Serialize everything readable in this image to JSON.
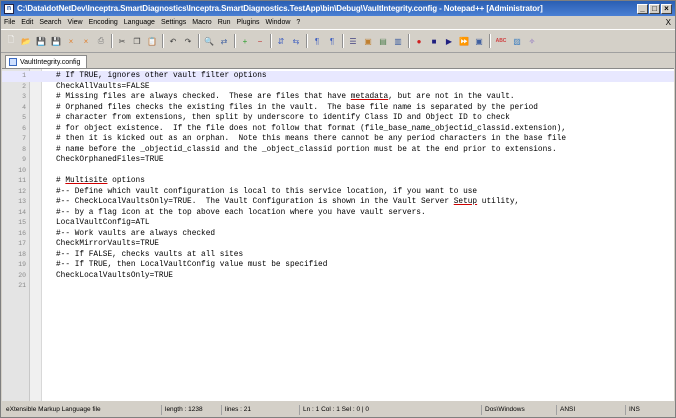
{
  "window": {
    "title": "C:\\Data\\dotNetDev\\Inceptra.SmartDiagnostics\\Inceptra.SmartDiagnostics.TestApp\\bin\\Debug\\VaultIntegrity.config - Notepad++ [Administrator]",
    "app_icon_glyph": "n",
    "controls": {
      "minimize": "_",
      "maximize": "□",
      "close": "×"
    }
  },
  "menu": {
    "items": [
      "File",
      "Edit",
      "Search",
      "View",
      "Encoding",
      "Language",
      "Settings",
      "Macro",
      "Run",
      "Plugins",
      "Window",
      "?"
    ],
    "close_doc": "X"
  },
  "toolbar": {
    "icons": [
      {
        "name": "new-file-icon",
        "glyph": "🗋",
        "color": "#ffffff"
      },
      {
        "name": "open-file-icon",
        "glyph": "📂",
        "color": "#f0c040"
      },
      {
        "name": "save-icon",
        "glyph": "💾",
        "color": "#6080c0"
      },
      {
        "name": "save-all-icon",
        "glyph": "💾",
        "color": "#6080c0"
      },
      {
        "name": "close-icon",
        "glyph": "×",
        "color": "#e08030"
      },
      {
        "name": "close-all-icon",
        "glyph": "×",
        "color": "#e08030"
      },
      {
        "name": "print-icon",
        "glyph": "⎙",
        "color": "#808080"
      },
      {
        "sep": true
      },
      {
        "name": "cut-icon",
        "glyph": "✂",
        "color": "#404040"
      },
      {
        "name": "copy-icon",
        "glyph": "❐",
        "color": "#404040"
      },
      {
        "name": "paste-icon",
        "glyph": "📋",
        "color": "#c09040"
      },
      {
        "sep": true
      },
      {
        "name": "undo-icon",
        "glyph": "↶",
        "color": "#404040"
      },
      {
        "name": "redo-icon",
        "glyph": "↷",
        "color": "#404040"
      },
      {
        "sep": true
      },
      {
        "name": "find-icon",
        "glyph": "🔍",
        "color": "#404040"
      },
      {
        "name": "replace-icon",
        "glyph": "⇄",
        "color": "#4060a0"
      },
      {
        "sep": true
      },
      {
        "name": "zoom-in-icon",
        "glyph": "+",
        "color": "#30a030"
      },
      {
        "name": "zoom-out-icon",
        "glyph": "−",
        "color": "#c03030"
      },
      {
        "sep": true
      },
      {
        "name": "sync-vertical-icon",
        "glyph": "⇵",
        "color": "#4060c0"
      },
      {
        "name": "sync-horizontal-icon",
        "glyph": "⇆",
        "color": "#4060c0"
      },
      {
        "sep": true
      },
      {
        "name": "word-wrap-icon",
        "glyph": "¶",
        "color": "#4060c0"
      },
      {
        "name": "show-all-chars-icon",
        "glyph": "¶",
        "color": "#4060c0"
      },
      {
        "sep": true
      },
      {
        "name": "indent-guide-icon",
        "glyph": "☰",
        "color": "#404080"
      },
      {
        "name": "language-icon",
        "glyph": "▣",
        "color": "#c08030"
      },
      {
        "name": "doc-map-icon",
        "glyph": "▤",
        "color": "#508050"
      },
      {
        "name": "function-list-icon",
        "glyph": "▥",
        "color": "#4060a0"
      },
      {
        "sep": true
      },
      {
        "name": "record-macro-icon",
        "glyph": "●",
        "color": "#d02020"
      },
      {
        "name": "stop-macro-icon",
        "glyph": "■",
        "color": "#202080"
      },
      {
        "name": "play-macro-icon",
        "glyph": "▶",
        "color": "#202080"
      },
      {
        "name": "run-macro-multiple-icon",
        "glyph": "⏩",
        "color": "#202080"
      },
      {
        "name": "save-macro-icon",
        "glyph": "▣",
        "color": "#4060a0"
      },
      {
        "sep": true
      },
      {
        "name": "spellcheck-icon",
        "glyph": "ABC",
        "color": "#d04040"
      },
      {
        "name": "plugin-icon",
        "glyph": "▨",
        "color": "#4080c0"
      },
      {
        "name": "tools-icon",
        "glyph": "✧",
        "color": "#8060c0"
      }
    ]
  },
  "tab": {
    "label": "VaultIntegrity.config"
  },
  "editor": {
    "current_line": 1,
    "lines": [
      {
        "n": "1",
        "text": "# If TRUE, ignores other vault filter options"
      },
      {
        "n": "2",
        "text": "CheckAllVaults=FALSE"
      },
      {
        "n": "3",
        "pre": "# Missing files are always checked.  These are files that have ",
        "u": "metadata",
        "post": ", but are not in the vault."
      },
      {
        "n": "4",
        "text": "# Orphaned files checks the existing files in the vault.  The base file name is separated by the period"
      },
      {
        "n": "5",
        "text": "# character from extensions, then split by underscore to identify Class ID and Object ID to check"
      },
      {
        "n": "6",
        "text": "# for object existence.  If the file does not follow that format (file_base_name_objectid_classid.extension),"
      },
      {
        "n": "7",
        "text": "# then it is kicked out as an orphan.  Note this means there cannot be any period characters in the base file"
      },
      {
        "n": "8",
        "text": "# name before the _objectid_classid and the _object_classid portion must be at the end prior to extensions."
      },
      {
        "n": "9",
        "text": "CheckOrphanedFiles=TRUE"
      },
      {
        "n": "10",
        "text": ""
      },
      {
        "n": "11",
        "pre": "# ",
        "u": "Multisite",
        "post": " options"
      },
      {
        "n": "12",
        "text": "#-- Define which vault configuration is local to this service location, if you want to use"
      },
      {
        "n": "13",
        "pre": "#-- CheckLocalVaultsOnly=TRUE.  The Vault Configuration is shown in the Vault Server ",
        "u": "Setup",
        "post": " utility,"
      },
      {
        "n": "14",
        "text": "#-- by a flag icon at the top above each location where you have vault servers."
      },
      {
        "n": "15",
        "text": "LocalVaultConfig=ATL"
      },
      {
        "n": "16",
        "text": "#-- Work vaults are always checked"
      },
      {
        "n": "17",
        "text": "CheckMirrorVaults=TRUE"
      },
      {
        "n": "18",
        "text": "#-- If FALSE, checks vaults at all sites"
      },
      {
        "n": "19",
        "text": "#-- If TRUE, then LocalVaultConfig value must be specified"
      },
      {
        "n": "20",
        "text": "CheckLocalVaultsOnly=TRUE"
      },
      {
        "n": "21",
        "text": ""
      }
    ]
  },
  "status": {
    "file_type": "eXtensible Markup Language file",
    "length": "length : 1238",
    "lines": "lines : 21",
    "position": "Ln : 1   Col : 1   Sel : 0 | 0",
    "eol": "Dos\\Windows",
    "encoding": "ANSI",
    "mode": "INS"
  }
}
